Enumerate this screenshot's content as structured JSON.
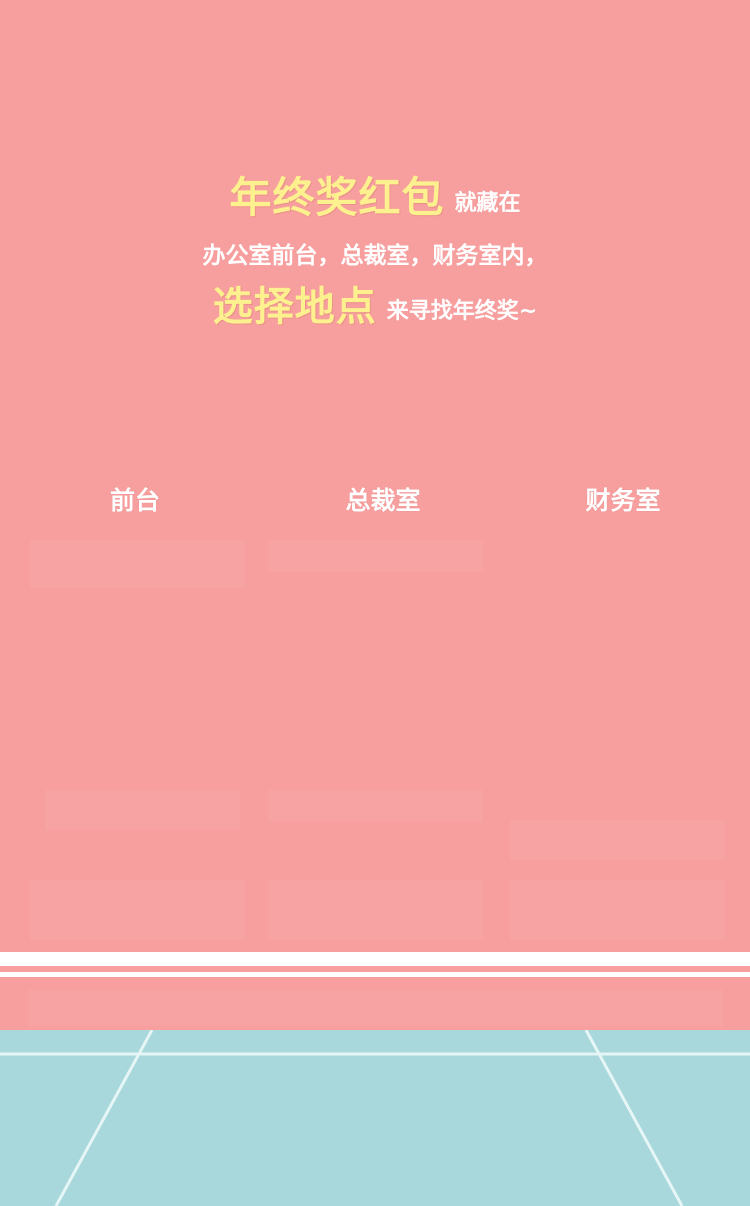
{
  "headline": {
    "line1_highlight": "年终奖红包",
    "line1_rest": "就藏在",
    "line2": "办公室前台，总裁室，财务室内，",
    "line3_highlight": "选择地点",
    "line3_rest": "来寻找年终奖~"
  },
  "locations": [
    {
      "label": "前台"
    },
    {
      "label": "总裁室"
    },
    {
      "label": "财务室"
    }
  ],
  "colors": {
    "wall": "#f79e9e",
    "highlight_text": "#fdf08e",
    "stripe": "#ffffff",
    "floor": "#a8d8dc"
  }
}
